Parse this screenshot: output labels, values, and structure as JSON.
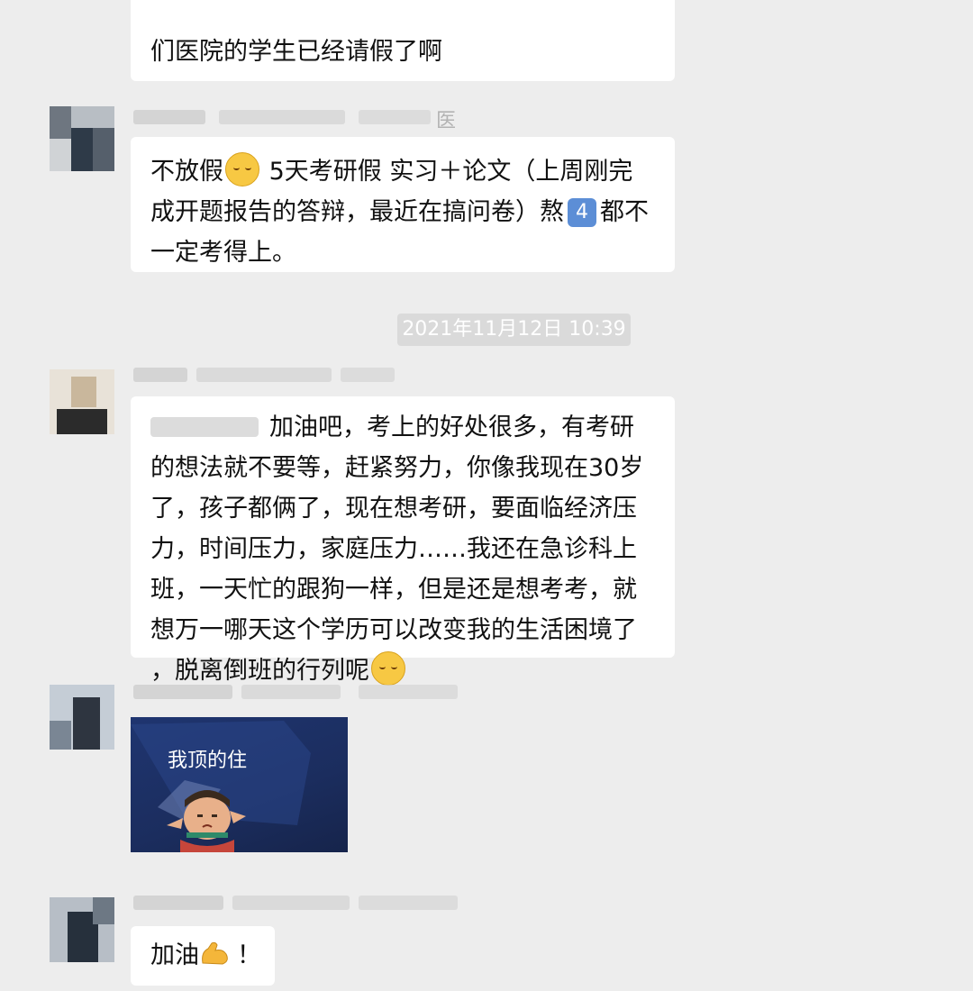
{
  "timestamp": "2021年11月12日 10:39",
  "messages": [
    {
      "lines": [
        "们医院的学生已经请假了啊"
      ]
    },
    {
      "sender_suffix": "医",
      "lines": [
        {
          "before": "不放假",
          "emoji": "smiling-face",
          "after": " 5天考研假 实习＋论文（上周刚完"
        },
        "成开题报告的答辩，最近在搞问卷）熬",
        "一定考得上。"
      ],
      "keycap": "4",
      "line2_tail": "都不"
    },
    {
      "lines": [
        "加油吧，考上的好处很多，有考研",
        "的想法就不要等，赶紧努力，你像我现在30岁",
        "了，孩子都俩了，现在想考研，要面临经济压",
        "力，时间压力，家庭压力……我还在急诊科上",
        "班，一天忙的跟狗一样，但是还是想考考，就",
        "想万一哪天这个学历可以改变我的生活困境了",
        "，脱离倒班的行列呢"
      ]
    },
    {
      "sticker_caption": "我顶的住"
    },
    {
      "text": "加油",
      "trailing": "！"
    }
  ],
  "icons": {
    "emoji_1": "grinning-face-icon",
    "keycap": "keycap-4-icon",
    "emoji_2": "thinking-face-icon",
    "emoji_3": "flexed-biceps-icon"
  }
}
